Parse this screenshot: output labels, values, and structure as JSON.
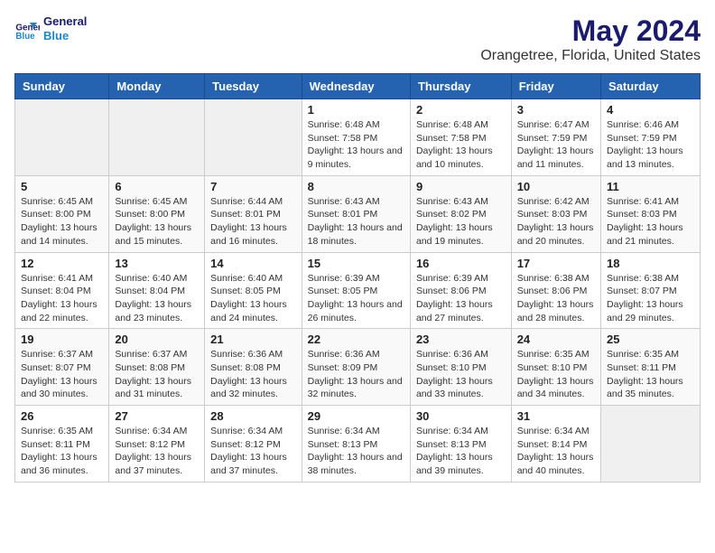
{
  "header": {
    "logo_line1": "General",
    "logo_line2": "Blue",
    "title": "May 2024",
    "subtitle": "Orangetree, Florida, United States"
  },
  "weekdays": [
    "Sunday",
    "Monday",
    "Tuesday",
    "Wednesday",
    "Thursday",
    "Friday",
    "Saturday"
  ],
  "weeks": [
    [
      {
        "day": "",
        "empty": true
      },
      {
        "day": "",
        "empty": true
      },
      {
        "day": "",
        "empty": true
      },
      {
        "day": "1",
        "sunrise": "6:48 AM",
        "sunset": "7:58 PM",
        "daylight": "13 hours and 9 minutes."
      },
      {
        "day": "2",
        "sunrise": "6:48 AM",
        "sunset": "7:58 PM",
        "daylight": "13 hours and 10 minutes."
      },
      {
        "day": "3",
        "sunrise": "6:47 AM",
        "sunset": "7:59 PM",
        "daylight": "13 hours and 11 minutes."
      },
      {
        "day": "4",
        "sunrise": "6:46 AM",
        "sunset": "7:59 PM",
        "daylight": "13 hours and 13 minutes."
      }
    ],
    [
      {
        "day": "5",
        "sunrise": "6:45 AM",
        "sunset": "8:00 PM",
        "daylight": "13 hours and 14 minutes."
      },
      {
        "day": "6",
        "sunrise": "6:45 AM",
        "sunset": "8:00 PM",
        "daylight": "13 hours and 15 minutes."
      },
      {
        "day": "7",
        "sunrise": "6:44 AM",
        "sunset": "8:01 PM",
        "daylight": "13 hours and 16 minutes."
      },
      {
        "day": "8",
        "sunrise": "6:43 AM",
        "sunset": "8:01 PM",
        "daylight": "13 hours and 18 minutes."
      },
      {
        "day": "9",
        "sunrise": "6:43 AM",
        "sunset": "8:02 PM",
        "daylight": "13 hours and 19 minutes."
      },
      {
        "day": "10",
        "sunrise": "6:42 AM",
        "sunset": "8:03 PM",
        "daylight": "13 hours and 20 minutes."
      },
      {
        "day": "11",
        "sunrise": "6:41 AM",
        "sunset": "8:03 PM",
        "daylight": "13 hours and 21 minutes."
      }
    ],
    [
      {
        "day": "12",
        "sunrise": "6:41 AM",
        "sunset": "8:04 PM",
        "daylight": "13 hours and 22 minutes."
      },
      {
        "day": "13",
        "sunrise": "6:40 AM",
        "sunset": "8:04 PM",
        "daylight": "13 hours and 23 minutes."
      },
      {
        "day": "14",
        "sunrise": "6:40 AM",
        "sunset": "8:05 PM",
        "daylight": "13 hours and 24 minutes."
      },
      {
        "day": "15",
        "sunrise": "6:39 AM",
        "sunset": "8:05 PM",
        "daylight": "13 hours and 26 minutes."
      },
      {
        "day": "16",
        "sunrise": "6:39 AM",
        "sunset": "8:06 PM",
        "daylight": "13 hours and 27 minutes."
      },
      {
        "day": "17",
        "sunrise": "6:38 AM",
        "sunset": "8:06 PM",
        "daylight": "13 hours and 28 minutes."
      },
      {
        "day": "18",
        "sunrise": "6:38 AM",
        "sunset": "8:07 PM",
        "daylight": "13 hours and 29 minutes."
      }
    ],
    [
      {
        "day": "19",
        "sunrise": "6:37 AM",
        "sunset": "8:07 PM",
        "daylight": "13 hours and 30 minutes."
      },
      {
        "day": "20",
        "sunrise": "6:37 AM",
        "sunset": "8:08 PM",
        "daylight": "13 hours and 31 minutes."
      },
      {
        "day": "21",
        "sunrise": "6:36 AM",
        "sunset": "8:08 PM",
        "daylight": "13 hours and 32 minutes."
      },
      {
        "day": "22",
        "sunrise": "6:36 AM",
        "sunset": "8:09 PM",
        "daylight": "13 hours and 32 minutes."
      },
      {
        "day": "23",
        "sunrise": "6:36 AM",
        "sunset": "8:10 PM",
        "daylight": "13 hours and 33 minutes."
      },
      {
        "day": "24",
        "sunrise": "6:35 AM",
        "sunset": "8:10 PM",
        "daylight": "13 hours and 34 minutes."
      },
      {
        "day": "25",
        "sunrise": "6:35 AM",
        "sunset": "8:11 PM",
        "daylight": "13 hours and 35 minutes."
      }
    ],
    [
      {
        "day": "26",
        "sunrise": "6:35 AM",
        "sunset": "8:11 PM",
        "daylight": "13 hours and 36 minutes."
      },
      {
        "day": "27",
        "sunrise": "6:34 AM",
        "sunset": "8:12 PM",
        "daylight": "13 hours and 37 minutes."
      },
      {
        "day": "28",
        "sunrise": "6:34 AM",
        "sunset": "8:12 PM",
        "daylight": "13 hours and 37 minutes."
      },
      {
        "day": "29",
        "sunrise": "6:34 AM",
        "sunset": "8:13 PM",
        "daylight": "13 hours and 38 minutes."
      },
      {
        "day": "30",
        "sunrise": "6:34 AM",
        "sunset": "8:13 PM",
        "daylight": "13 hours and 39 minutes."
      },
      {
        "day": "31",
        "sunrise": "6:34 AM",
        "sunset": "8:14 PM",
        "daylight": "13 hours and 40 minutes."
      },
      {
        "day": "",
        "empty": true
      }
    ]
  ],
  "labels": {
    "sunrise_prefix": "Sunrise: ",
    "sunset_prefix": "Sunset: ",
    "daylight_prefix": "Daylight: "
  }
}
